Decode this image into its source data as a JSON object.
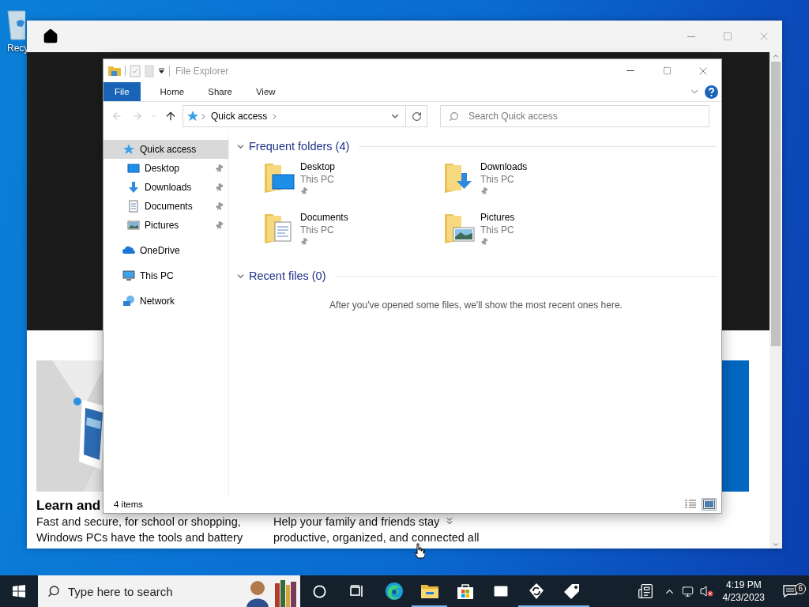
{
  "desktop_icons": [
    {
      "label": "Recy"
    }
  ],
  "background_window": {
    "heading": "Learn and",
    "columns": [
      {
        "lines": [
          "Fast and secure, for school or shopping,",
          "Windows PCs have the tools and battery"
        ]
      },
      {
        "lines": [
          "Help your family and friends stay",
          "productive, organized, and connected all"
        ]
      }
    ]
  },
  "explorer": {
    "title": "File Explorer",
    "ribbon_tabs": [
      {
        "label": "File",
        "kind": "backstage"
      },
      {
        "label": "Home",
        "kind": "tab"
      },
      {
        "label": "Share",
        "kind": "tab"
      },
      {
        "label": "View",
        "kind": "tab"
      }
    ],
    "address": {
      "crumbs": [
        "Quick access"
      ]
    },
    "search": {
      "placeholder": "Search Quick access"
    },
    "nav": [
      {
        "label": "Quick access",
        "kind": "quick",
        "selected": true,
        "children": [
          {
            "label": "Desktop",
            "kind": "desktop",
            "pinned": true,
            "selected": false
          },
          {
            "label": "Downloads",
            "kind": "downloads",
            "pinned": true,
            "selected": false
          },
          {
            "label": "Documents",
            "kind": "documents",
            "pinned": true,
            "selected": false
          },
          {
            "label": "Pictures",
            "kind": "pictures",
            "pinned": true,
            "selected": false
          }
        ]
      },
      {
        "label": "OneDrive",
        "kind": "onedrive",
        "selected": false
      },
      {
        "label": "This PC",
        "kind": "pc",
        "selected": false
      },
      {
        "label": "Network",
        "kind": "network",
        "selected": false
      }
    ],
    "groups": [
      {
        "title": "Frequent folders (4)",
        "expanded": true,
        "items": [
          {
            "name": "Desktop",
            "location": "This PC",
            "kind": "desktop",
            "pinned": true
          },
          {
            "name": "Downloads",
            "location": "This PC",
            "kind": "downloads",
            "pinned": true
          },
          {
            "name": "Documents",
            "location": "This PC",
            "kind": "documents",
            "pinned": true
          },
          {
            "name": "Pictures",
            "location": "This PC",
            "kind": "pictures",
            "pinned": true
          }
        ]
      },
      {
        "title": "Recent files (0)",
        "expanded": true,
        "empty_message": "After you've opened some files, we'll show the most recent ones here."
      }
    ],
    "status": "4 items",
    "views": [
      {
        "kind": "details",
        "selected": false
      },
      {
        "kind": "tiles",
        "selected": true
      }
    ]
  },
  "taskbar": {
    "search_placeholder": "Type here to search",
    "apps": [
      {
        "kind": "cortana",
        "running": false
      },
      {
        "kind": "taskview",
        "running": false
      },
      {
        "kind": "edge",
        "running": false
      },
      {
        "kind": "explorer",
        "running": true
      },
      {
        "kind": "store",
        "running": false
      },
      {
        "kind": "mail",
        "running": false
      },
      {
        "kind": "sync",
        "running": true
      },
      {
        "kind": "tag",
        "running": true
      }
    ],
    "time": "4:19 PM",
    "date": "4/23/2023",
    "notifications": "6"
  }
}
